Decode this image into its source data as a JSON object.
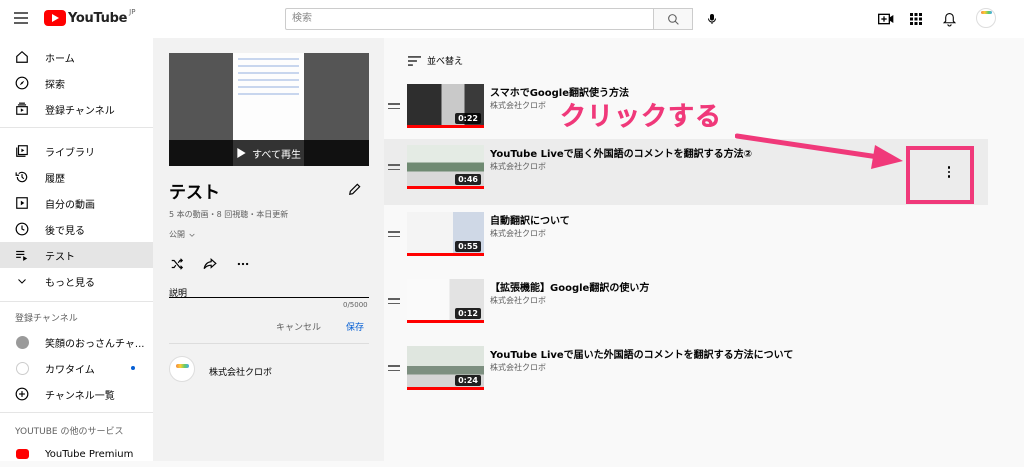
{
  "header": {
    "logo_text": "YouTube",
    "region": "JP",
    "search_placeholder": "検索",
    "icons": [
      "menu-icon",
      "search-icon",
      "mic-icon",
      "create-video-icon",
      "apps-icon",
      "notifications-icon"
    ]
  },
  "sidebar": {
    "main": [
      {
        "label": "ホーム",
        "icon": "home-icon"
      },
      {
        "label": "探索",
        "icon": "explore-icon"
      },
      {
        "label": "登録チャンネル",
        "icon": "subscriptions-icon"
      }
    ],
    "library": [
      {
        "label": "ライブラリ",
        "icon": "library-icon"
      },
      {
        "label": "履歴",
        "icon": "history-icon"
      },
      {
        "label": "自分の動画",
        "icon": "your-videos-icon"
      },
      {
        "label": "後で見る",
        "icon": "watch-later-icon"
      },
      {
        "label": "テスト",
        "icon": "playlist-icon"
      },
      {
        "label": "もっと見る",
        "icon": "chevron-down-icon"
      }
    ],
    "subscriptions_header": "登録チャンネル",
    "subscriptions": [
      {
        "label": "笑顔のおっさんチャ..."
      },
      {
        "label": "カワタイム"
      },
      {
        "label": "チャンネル一覧"
      }
    ],
    "services_header": "YOUTUBE の他のサービス",
    "services": [
      {
        "label": "YouTube Premium"
      }
    ]
  },
  "playlist": {
    "play_all": "すべて再生",
    "title": "テスト",
    "stats": "5 本の動画・8 回視聴・本日更新",
    "privacy": "公開",
    "description_label": "説明",
    "description_count": "0/5000",
    "cancel": "キャンセル",
    "save": "保存",
    "owner": "株式会社クロボ"
  },
  "list": {
    "sort_label": "並べ替え",
    "videos": [
      {
        "title": "スマホでGoogle翻訳使う方法",
        "channel": "株式会社クロボ",
        "duration": "0:22"
      },
      {
        "title": "YouTube Liveで届く外国語のコメントを翻訳する方法②",
        "channel": "株式会社クロボ",
        "duration": "0:46"
      },
      {
        "title": "自動翻訳について",
        "channel": "株式会社クロボ",
        "duration": "0:55"
      },
      {
        "title": "【拡張機能】Google翻訳の使い方",
        "channel": "株式会社クロボ",
        "duration": "0:12"
      },
      {
        "title": "YouTube Liveで届いた外国語のコメントを翻訳する方法について",
        "channel": "株式会社クロボ",
        "duration": "0:24"
      }
    ]
  },
  "annotation": {
    "text": "クリックする",
    "color": "#f0397a"
  }
}
